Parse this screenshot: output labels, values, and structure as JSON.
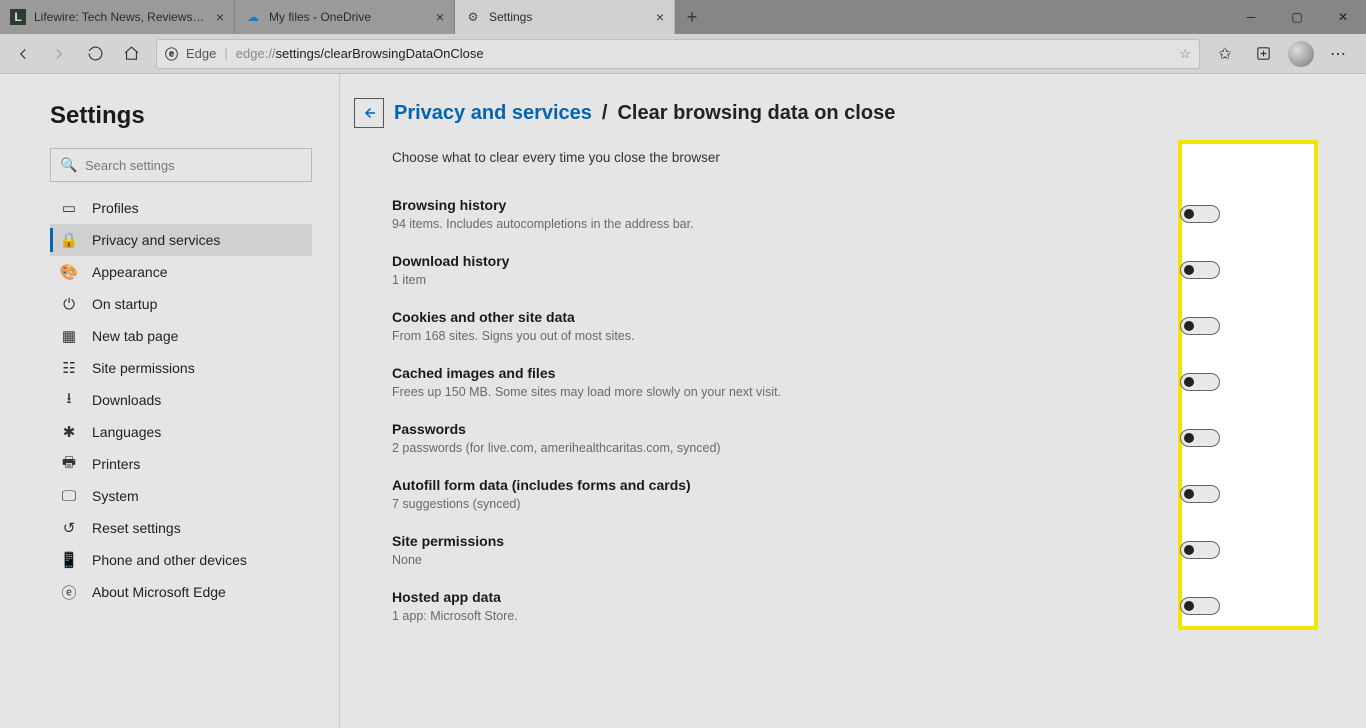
{
  "tabs": [
    {
      "title": "Lifewire: Tech News, Reviews, He",
      "favicon": "L",
      "active": false
    },
    {
      "title": "My files - OneDrive",
      "favicon": "cloud",
      "active": false
    },
    {
      "title": "Settings",
      "favicon": "gear",
      "active": true
    }
  ],
  "toolbar": {
    "identity": "Edge",
    "url_prefix": "edge://",
    "url_path": "settings/clearBrowsingDataOnClose"
  },
  "sidebar": {
    "heading": "Settings",
    "search_placeholder": "Search settings",
    "items": [
      {
        "label": "Profiles",
        "icon": "profile"
      },
      {
        "label": "Privacy and services",
        "icon": "lock",
        "active": true
      },
      {
        "label": "Appearance",
        "icon": "palette"
      },
      {
        "label": "On startup",
        "icon": "power"
      },
      {
        "label": "New tab page",
        "icon": "newtab"
      },
      {
        "label": "Site permissions",
        "icon": "permissions"
      },
      {
        "label": "Downloads",
        "icon": "download"
      },
      {
        "label": "Languages",
        "icon": "language"
      },
      {
        "label": "Printers",
        "icon": "printer"
      },
      {
        "label": "System",
        "icon": "system"
      },
      {
        "label": "Reset settings",
        "icon": "reset"
      },
      {
        "label": "Phone and other devices",
        "icon": "phone"
      },
      {
        "label": "About Microsoft Edge",
        "icon": "edge"
      }
    ]
  },
  "main": {
    "breadcrumb_link": "Privacy and services",
    "breadcrumb_sep": "/",
    "breadcrumb_current": "Clear browsing data on close",
    "intro": "Choose what to clear every time you close the browser",
    "options": [
      {
        "title": "Browsing history",
        "desc": "94 items. Includes autocompletions in the address bar.",
        "on": false
      },
      {
        "title": "Download history",
        "desc": "1 item",
        "on": false
      },
      {
        "title": "Cookies and other site data",
        "desc": "From 168 sites. Signs you out of most sites.",
        "on": false
      },
      {
        "title": "Cached images and files",
        "desc": "Frees up 150 MB. Some sites may load more slowly on your next visit.",
        "on": false
      },
      {
        "title": "Passwords",
        "desc": "2 passwords (for live.com, amerihealthcaritas.com, synced)",
        "on": false
      },
      {
        "title": "Autofill form data (includes forms and cards)",
        "desc": "7 suggestions (synced)",
        "on": false
      },
      {
        "title": "Site permissions",
        "desc": "None",
        "on": false
      },
      {
        "title": "Hosted app data",
        "desc": "1 app: Microsoft Store.",
        "on": false
      }
    ]
  }
}
